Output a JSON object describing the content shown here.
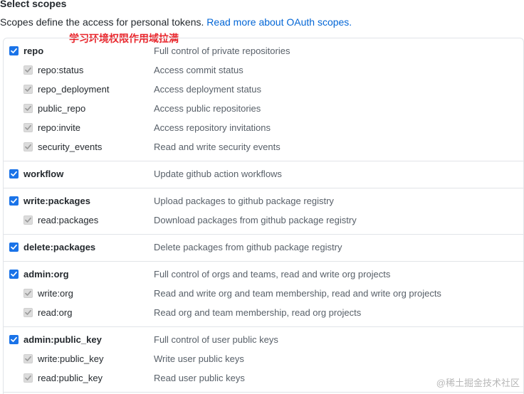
{
  "header": {
    "title": "Select scopes",
    "description": "Scopes define the access for personal tokens.",
    "link_text": "Read more about OAuth scopes."
  },
  "annotation": "学习环境权限作用域拉满",
  "scopes": [
    {
      "name": "repo",
      "desc": "Full control of private repositories",
      "children": [
        {
          "name": "repo:status",
          "desc": "Access commit status"
        },
        {
          "name": "repo_deployment",
          "desc": "Access deployment status"
        },
        {
          "name": "public_repo",
          "desc": "Access public repositories"
        },
        {
          "name": "repo:invite",
          "desc": "Access repository invitations"
        },
        {
          "name": "security_events",
          "desc": "Read and write security events"
        }
      ]
    },
    {
      "name": "workflow",
      "desc": "Update github action workflows",
      "children": []
    },
    {
      "name": "write:packages",
      "desc": "Upload packages to github package registry",
      "children": [
        {
          "name": "read:packages",
          "desc": "Download packages from github package registry"
        }
      ]
    },
    {
      "name": "delete:packages",
      "desc": "Delete packages from github package registry",
      "children": []
    },
    {
      "name": "admin:org",
      "desc": "Full control of orgs and teams, read and write org projects",
      "children": [
        {
          "name": "write:org",
          "desc": "Read and write org and team membership, read and write org projects"
        },
        {
          "name": "read:org",
          "desc": "Read org and team membership, read org projects"
        }
      ]
    },
    {
      "name": "admin:public_key",
      "desc": "Full control of user public keys",
      "children": [
        {
          "name": "write:public_key",
          "desc": "Write user public keys"
        },
        {
          "name": "read:public_key",
          "desc": "Read user public keys"
        }
      ]
    }
  ],
  "watermark": "@稀土掘金技术社区",
  "colors": {
    "checkbox_checked": "#1a73e8",
    "checkbox_disabled": "#dcdcdc",
    "link": "#0366d6",
    "annotation": "#e8242a"
  }
}
